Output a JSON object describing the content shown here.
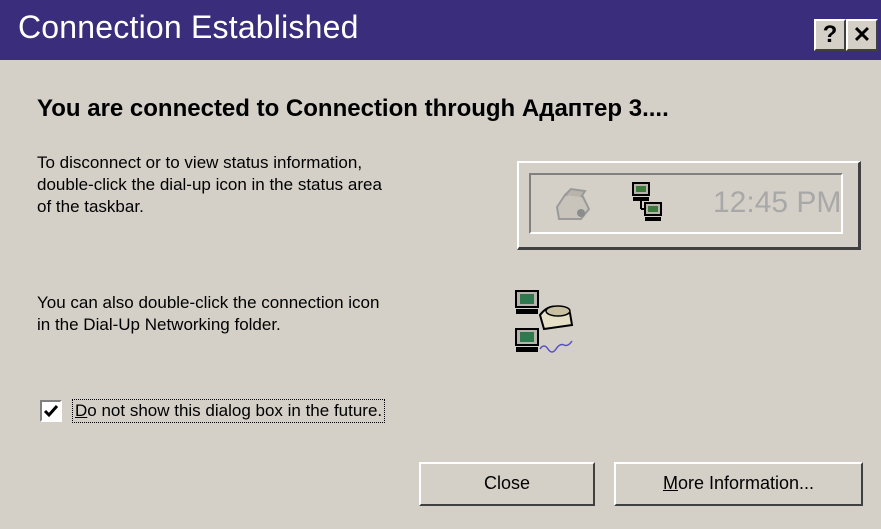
{
  "window": {
    "title": "Connection Established",
    "help_label": "?",
    "close_label": "✕"
  },
  "heading": "You are connected to Connection through Адаптер 3....",
  "info_text": "To disconnect or to view status information,\ndouble-click the dial-up icon in the status area\nof the taskbar.",
  "tray": {
    "time": "12:45 PM",
    "icons": [
      "printer-icon",
      "network-computers-icon"
    ]
  },
  "folder_text": "You can also double-click the connection icon\nin the Dial-Up Networking folder.",
  "folder_icon": "dial-up-connection-icon",
  "checkbox": {
    "checked": true,
    "label_first": "D",
    "label_rest": "o not show this dialog box in the future."
  },
  "buttons": {
    "close": "Close",
    "more_first": "M",
    "more_rest": "ore Information..."
  },
  "colors": {
    "titlebar": "#3a2e7c",
    "face": "#d4d0c8"
  }
}
